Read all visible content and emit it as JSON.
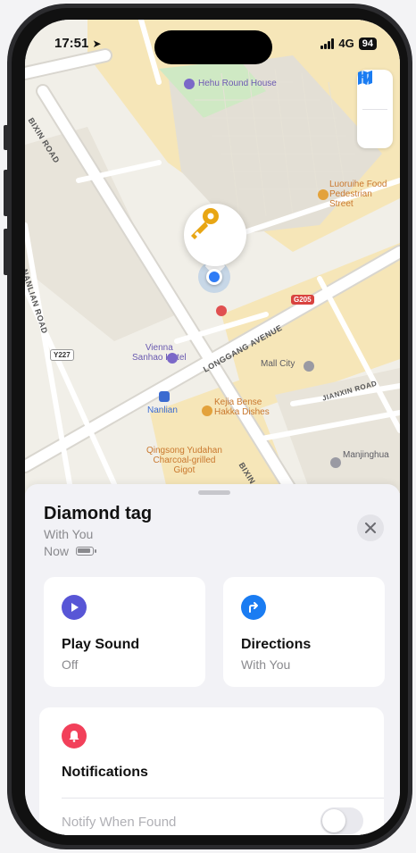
{
  "status_bar": {
    "time": "17:51",
    "network": "4G",
    "battery": "94"
  },
  "map": {
    "labels": {
      "hehu": "Hehu Round House",
      "luoruihe": "Luoruihe Food\nPedestrian\nStreet",
      "vienna": "Vienna\nSanhao Hotel",
      "nanlian": "Nanlian",
      "kejia": "Kejia Bense\nHakka Dishes",
      "qingsong": "Qingsong Yudahan\nCharcoal-grilled\nGigot",
      "mall_city": "Mall City",
      "manjinghua": "Manjinghua"
    },
    "roads": {
      "bixin_top": "BIXIN ROAD",
      "bixin_bottom": "BIXIN",
      "nanlian_road": "NANLIAN ROAD",
      "longgang": "LONGGANG AVENUE",
      "jianxin": "JIANXIN ROAD"
    },
    "badges": {
      "g205": "G205",
      "y227": "Y227"
    },
    "colors": {
      "park": "#cfe9c4",
      "block": "#f6e6b8",
      "road": "#ffffff",
      "base": "#f1efe8",
      "road_edge": "#d9d6cf"
    }
  },
  "item": {
    "name": "Diamond tag",
    "location": "With You",
    "updated": "Now",
    "icon": "key-icon"
  },
  "actions": [
    {
      "label": "Play Sound",
      "sub": "Off",
      "icon": "play-icon",
      "color": "#5856d6"
    },
    {
      "label": "Directions",
      "sub": "With You",
      "icon": "directions-icon",
      "color": "#1a7cf2"
    }
  ],
  "notifications": {
    "title": "Notifications",
    "icon": "bell-icon",
    "color": "#f2405a",
    "notify_when_found": "Notify When Found",
    "notify_when_found_on": false
  }
}
